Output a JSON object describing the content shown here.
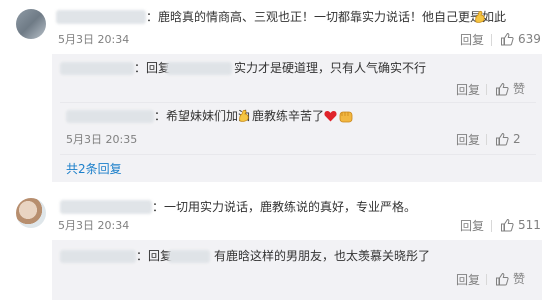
{
  "comment1": {
    "text": "：鹿晗真的情商高、三观也正！一切都靠实力说话！他自己更是如此",
    "time": "5月3日 20:34",
    "reply_label": "回复",
    "like_count": "639",
    "replies": [
      {
        "prefix": "：回复",
        "text": "实力才是硬道理，只有人气确实不行",
        "reply_label": "回复",
        "like_label": "赞"
      },
      {
        "text": "：希望妹妹们加油",
        "text2": "鹿教练辛苦了",
        "time": "5月3日 20:35",
        "reply_label": "回复",
        "like_count": "2"
      }
    ],
    "more_replies": "共2条回复"
  },
  "comment2": {
    "text": "：一切用实力说话，鹿教练说的真好，专业严格。",
    "time": "5月3日 20:34",
    "reply_label": "回复",
    "like_count": "511",
    "replies": [
      {
        "prefix": "：回复",
        "text": "有鹿晗这样的男朋友，也太羡慕关晓彤了",
        "reply_label": "回复",
        "like_label": "赞"
      }
    ]
  },
  "icons": {
    "like": "thumbs-up-icon",
    "muscle": "flexed-biceps-emoji",
    "heart": "red-heart-emoji",
    "fist": "raised-fist-emoji"
  },
  "colors": {
    "username": "#eb7350",
    "link": "#1b7fca",
    "muted": "#808080",
    "reply_bg": "#f2f2f5"
  }
}
